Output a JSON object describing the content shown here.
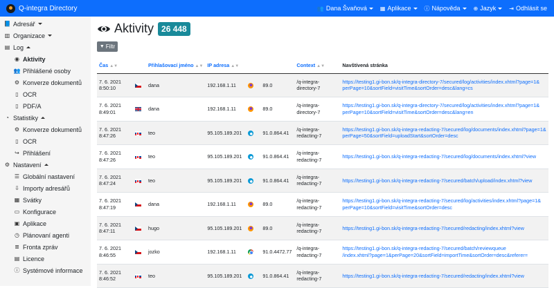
{
  "app": {
    "title": "Q-integra Directory"
  },
  "topnav": {
    "user": "Dana Švaňová",
    "apps": "Aplikace",
    "help": "Nápověda",
    "language": "Jazyk",
    "logout": "Odhlásit se"
  },
  "sidebar": {
    "items": [
      {
        "label": "Adresář",
        "icon": "book-icon",
        "level": 0,
        "caret": "down"
      },
      {
        "label": "Organizace",
        "icon": "building-icon",
        "level": 0,
        "caret": "down"
      },
      {
        "label": "Log",
        "icon": "file-icon",
        "level": 0,
        "caret": "up"
      },
      {
        "label": "Aktivity",
        "icon": "eye-icon",
        "level": 1,
        "active": true
      },
      {
        "label": "Přihlášené osoby",
        "icon": "users-icon",
        "level": 1
      },
      {
        "label": "Konverze dokumentů",
        "icon": "cogs-icon",
        "level": 1
      },
      {
        "label": "OCR",
        "icon": "document-icon",
        "level": 1
      },
      {
        "label": "PDF/A",
        "icon": "document-icon",
        "level": 1
      },
      {
        "label": "Statistiky",
        "icon": "gauge-icon",
        "level": 0,
        "caret": "up"
      },
      {
        "label": "Konverze dokumentů",
        "icon": "cogs-icon",
        "level": 1
      },
      {
        "label": "OCR",
        "icon": "document-icon",
        "level": 1
      },
      {
        "label": "Přihlášení",
        "icon": "login-icon",
        "level": 1
      },
      {
        "label": "Nastavení",
        "icon": "gear-icon",
        "level": 0,
        "caret": "up"
      },
      {
        "label": "Globální nastavení",
        "icon": "list-icon",
        "level": 1
      },
      {
        "label": "Importy adresářů",
        "icon": "import-icon",
        "level": 1
      },
      {
        "label": "Svátky",
        "icon": "calendar-icon",
        "level": 1
      },
      {
        "label": "Konfigurace",
        "icon": "folder-icon",
        "level": 1
      },
      {
        "label": "Aplikace",
        "icon": "apps-icon",
        "level": 1
      },
      {
        "label": "Plánovaní agenti",
        "icon": "clock-icon",
        "level": 1
      },
      {
        "label": "Fronta zpráv",
        "icon": "queue-icon",
        "level": 1
      },
      {
        "label": "Licence",
        "icon": "license-icon",
        "level": 1
      },
      {
        "label": "Systémové informace",
        "icon": "info-icon",
        "level": 1
      }
    ]
  },
  "main": {
    "title": "Aktivity",
    "count": "26 448",
    "filter_label": "Filtr",
    "columns": [
      "Čas",
      "",
      "Přihlašovací jméno",
      "IP adresa",
      "",
      "",
      "Context",
      "Navštívená stránka"
    ],
    "rows": [
      {
        "date": "7. 6. 2021",
        "time": "8:50:10",
        "flag": "cz",
        "user": "dana",
        "ip": "192.168.1.11",
        "browser": "firefox",
        "version": "89.0",
        "ctx1": "/q-integra-",
        "ctx2": "directory-7",
        "url1": "https://testing1.gi-bon.sk/q-integra-directory-7/secured/log/activities/index.xhtml?page=1&",
        "url2": "perPage=10&sortField=visitTime&sortOrder=desc&lang=cs"
      },
      {
        "date": "7. 6. 2021",
        "time": "8:49:01",
        "flag": "gb",
        "user": "dana",
        "ip": "192.168.1.11",
        "browser": "firefox",
        "version": "89.0",
        "ctx1": "/q-integra-",
        "ctx2": "directory-7",
        "url1": "https://testing1.gi-bon.sk/q-integra-directory-7/secured/log/activities/index.xhtml?page=1&",
        "url2": "perPage=10&sortField=visitTime&sortOrder=desc&lang=en"
      },
      {
        "date": "7. 6. 2021",
        "time": "8:47:26",
        "flag": "sk",
        "user": "teo",
        "ip": "95.105.189.201",
        "browser": "edge",
        "version": "91.0.864.41",
        "ctx1": "/q-integra-",
        "ctx2": "redacting-7",
        "url1": "https://testing1.gi-bon.sk/q-integra-redacting-7/secured/log/documents/index.xhtml?page=1&",
        "url2": "perPage=50&sortField=uploadStart&sortOrder=desc"
      },
      {
        "date": "7. 6. 2021",
        "time": "8:47:26",
        "flag": "sk",
        "user": "teo",
        "ip": "95.105.189.201",
        "browser": "edge",
        "version": "91.0.864.41",
        "ctx1": "/q-integra-",
        "ctx2": "redacting-7",
        "url1": "https://testing1.gi-bon.sk/q-integra-redacting-7/secured/log/documents/index.xhtml?view",
        "url2": ""
      },
      {
        "date": "7. 6. 2021",
        "time": "8:47:24",
        "flag": "sk",
        "user": "teo",
        "ip": "95.105.189.201",
        "browser": "edge",
        "version": "91.0.864.41",
        "ctx1": "/q-integra-",
        "ctx2": "redacting-7",
        "url1": "https://testing1.gi-bon.sk/q-integra-redacting-7/secured/batch/upload/index.xhtml?view",
        "url2": ""
      },
      {
        "date": "7. 6. 2021",
        "time": "8:47:19",
        "flag": "cz",
        "user": "dana",
        "ip": "192.168.1.11",
        "browser": "firefox",
        "version": "89.0",
        "ctx1": "/q-integra-",
        "ctx2": "redacting-7",
        "url1": "https://testing1.gi-bon.sk/q-integra-redacting-7/secured/log/activities/index.xhtml?page=1&",
        "url2": "perPage=10&sortField=visitTime&sortOrder=desc"
      },
      {
        "date": "7. 6. 2021",
        "time": "8:47:11",
        "flag": "cz",
        "user": "hugo",
        "ip": "95.105.189.201",
        "browser": "firefox",
        "version": "89.0",
        "ctx1": "/q-integra-",
        "ctx2": "redacting-7",
        "url1": "https://testing1.gi-bon.sk/q-integra-redacting-7/secured/redacting/index.xhtml?view",
        "url2": ""
      },
      {
        "date": "7. 6. 2021",
        "time": "8:46:55",
        "flag": "cz",
        "user": "jozko",
        "ip": "192.168.1.11",
        "browser": "chrome",
        "version": "91.0.4472.77",
        "ctx1": "/q-integra-",
        "ctx2": "redacting-7",
        "url1": "https://testing1.gi-bon.sk/q-integra-redacting-7/secured/batch/reviewqueue",
        "url2": "/index.xhtml?page=1&perPage=20&sortField=importTime&sortOrder=desc&referer="
      },
      {
        "date": "7. 6. 2021",
        "time": "8:46:52",
        "flag": "sk",
        "user": "teo",
        "ip": "95.105.189.201",
        "browser": "edge",
        "version": "91.0.864.41",
        "ctx1": "/q-integra-",
        "ctx2": "redacting-7",
        "url1": "https://testing1.gi-bon.sk/q-integra-redacting-7/secured/redacting/index.xhtml?view",
        "url2": ""
      }
    ]
  },
  "colors": {
    "primary": "#0d6efd",
    "badge": "#198a9a",
    "filter": "#6c757d"
  }
}
